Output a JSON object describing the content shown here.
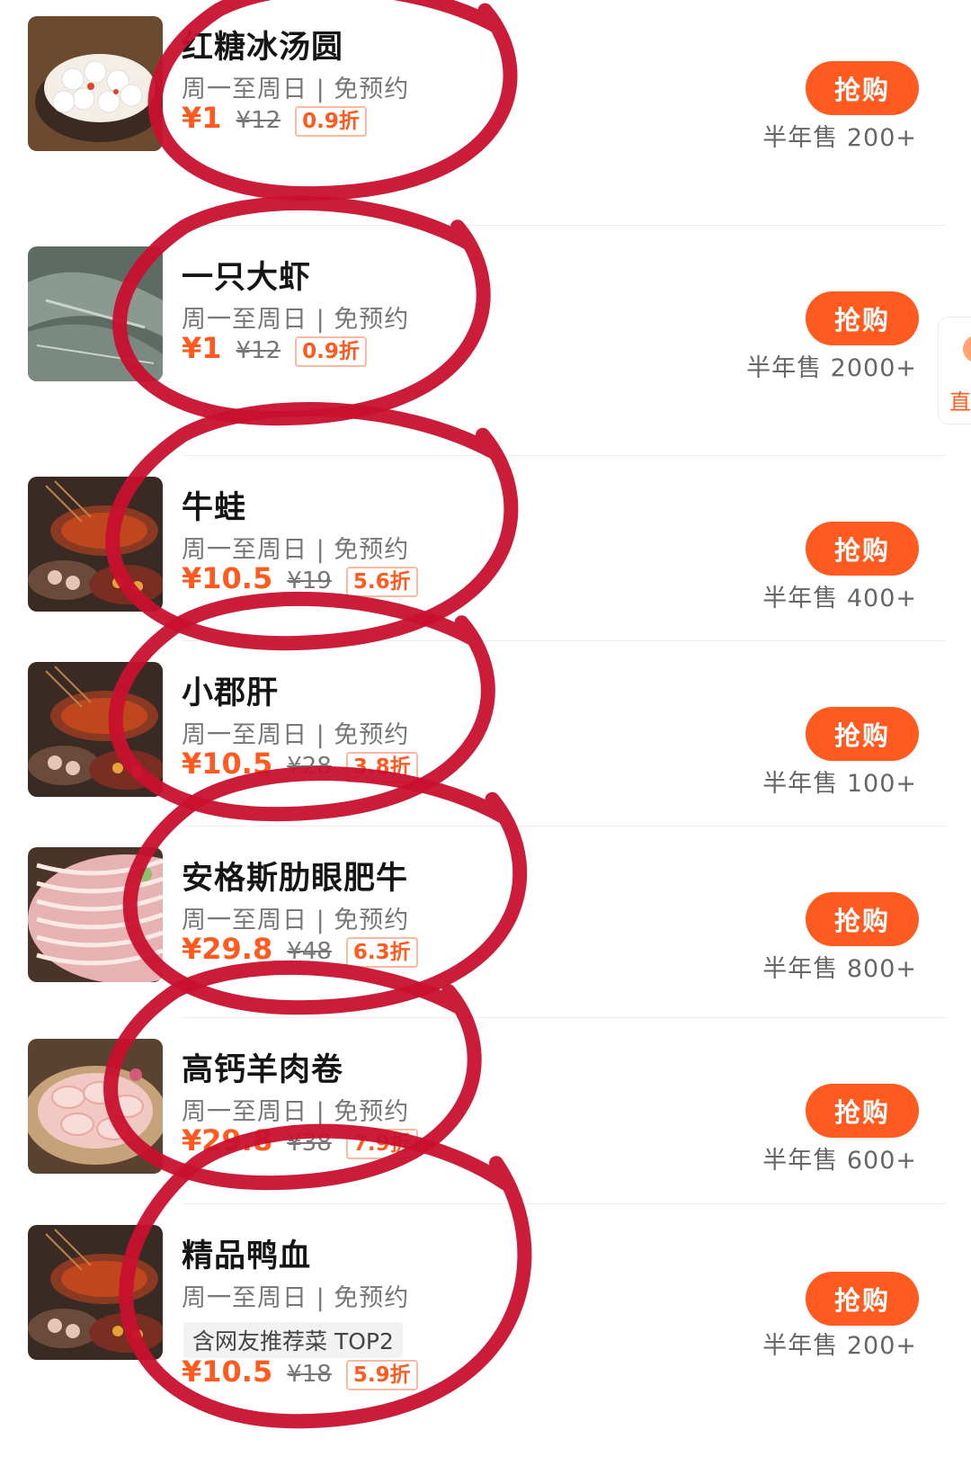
{
  "deals": [
    {
      "name": "红糖冰汤圆",
      "availability": "周一至周日 | 免预约",
      "tag": "",
      "price": "¥1",
      "original_price": "¥12",
      "discount": "0.9折",
      "button": "抢购",
      "sold": "半年售 200+",
      "image": "sweet-rice-balls-thumbnail"
    },
    {
      "name": "一只大虾",
      "availability": "周一至周日 | 免预约",
      "tag": "",
      "price": "¥1",
      "original_price": "¥12",
      "discount": "0.9折",
      "button": "抢购",
      "sold": "半年售 2000+",
      "image": "shrimp-thumbnail"
    },
    {
      "name": "牛蛙",
      "availability": "周一至周日 | 免预约",
      "tag": "",
      "price": "¥10.5",
      "original_price": "¥19",
      "discount": "5.6折",
      "button": "抢购",
      "sold": "半年售 400+",
      "image": "hotpot-table-thumbnail"
    },
    {
      "name": "小郡肝",
      "availability": "周一至周日 | 免预约",
      "tag": "",
      "price": "¥10.5",
      "original_price": "¥28",
      "discount": "3.8折",
      "button": "抢购",
      "sold": "半年售 100+",
      "image": "hotpot-table-thumbnail"
    },
    {
      "name": "安格斯肋眼肥牛",
      "availability": "周一至周日 | 免预约",
      "tag": "",
      "price": "¥29.8",
      "original_price": "¥48",
      "discount": "6.3折",
      "button": "抢购",
      "sold": "半年售 800+",
      "image": "beef-slices-thumbnail"
    },
    {
      "name": "高钙羊肉卷",
      "availability": "周一至周日 | 免预约",
      "tag": "",
      "price": "¥29.8",
      "original_price": "¥38",
      "discount": "7.9折",
      "button": "抢购",
      "sold": "半年售 600+",
      "image": "lamb-rolls-thumbnail"
    },
    {
      "name": "精品鸭血",
      "availability": "周一至周日 | 免预约",
      "tag": "含网友推荐菜 TOP2",
      "price": "¥10.5",
      "original_price": "¥18",
      "discount": "5.9折",
      "button": "抢购",
      "sold": "半年售 200+",
      "image": "hotpot-table-thumbnail"
    }
  ],
  "side_tab": {
    "label": "直"
  },
  "colors": {
    "accent": "#ff5a1f",
    "annotation": "#c8102e",
    "divider": "#eeeeee"
  }
}
